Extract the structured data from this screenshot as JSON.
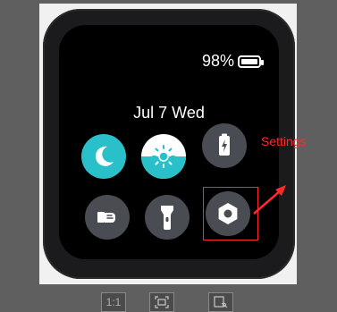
{
  "status": {
    "battery_percent": "98%",
    "battery_level": 0.98
  },
  "date_label": "Jul 7 Wed",
  "controls": [
    {
      "icon": "moon-icon",
      "active": true
    },
    {
      "icon": "brightness-icon",
      "active": true
    },
    {
      "icon": "battery-charging-icon",
      "active": false
    },
    {
      "icon": "find-phone-icon",
      "active": false
    },
    {
      "icon": "flashlight-icon",
      "active": false
    },
    {
      "icon": "settings-gear-icon",
      "active": false
    }
  ],
  "annotation": {
    "label": "Settings",
    "color": "#ff2a2a"
  },
  "toolbar": {
    "fit_label": "1:1"
  },
  "colors": {
    "accent": "#2ac0c9",
    "tile": "#4a4c53"
  }
}
